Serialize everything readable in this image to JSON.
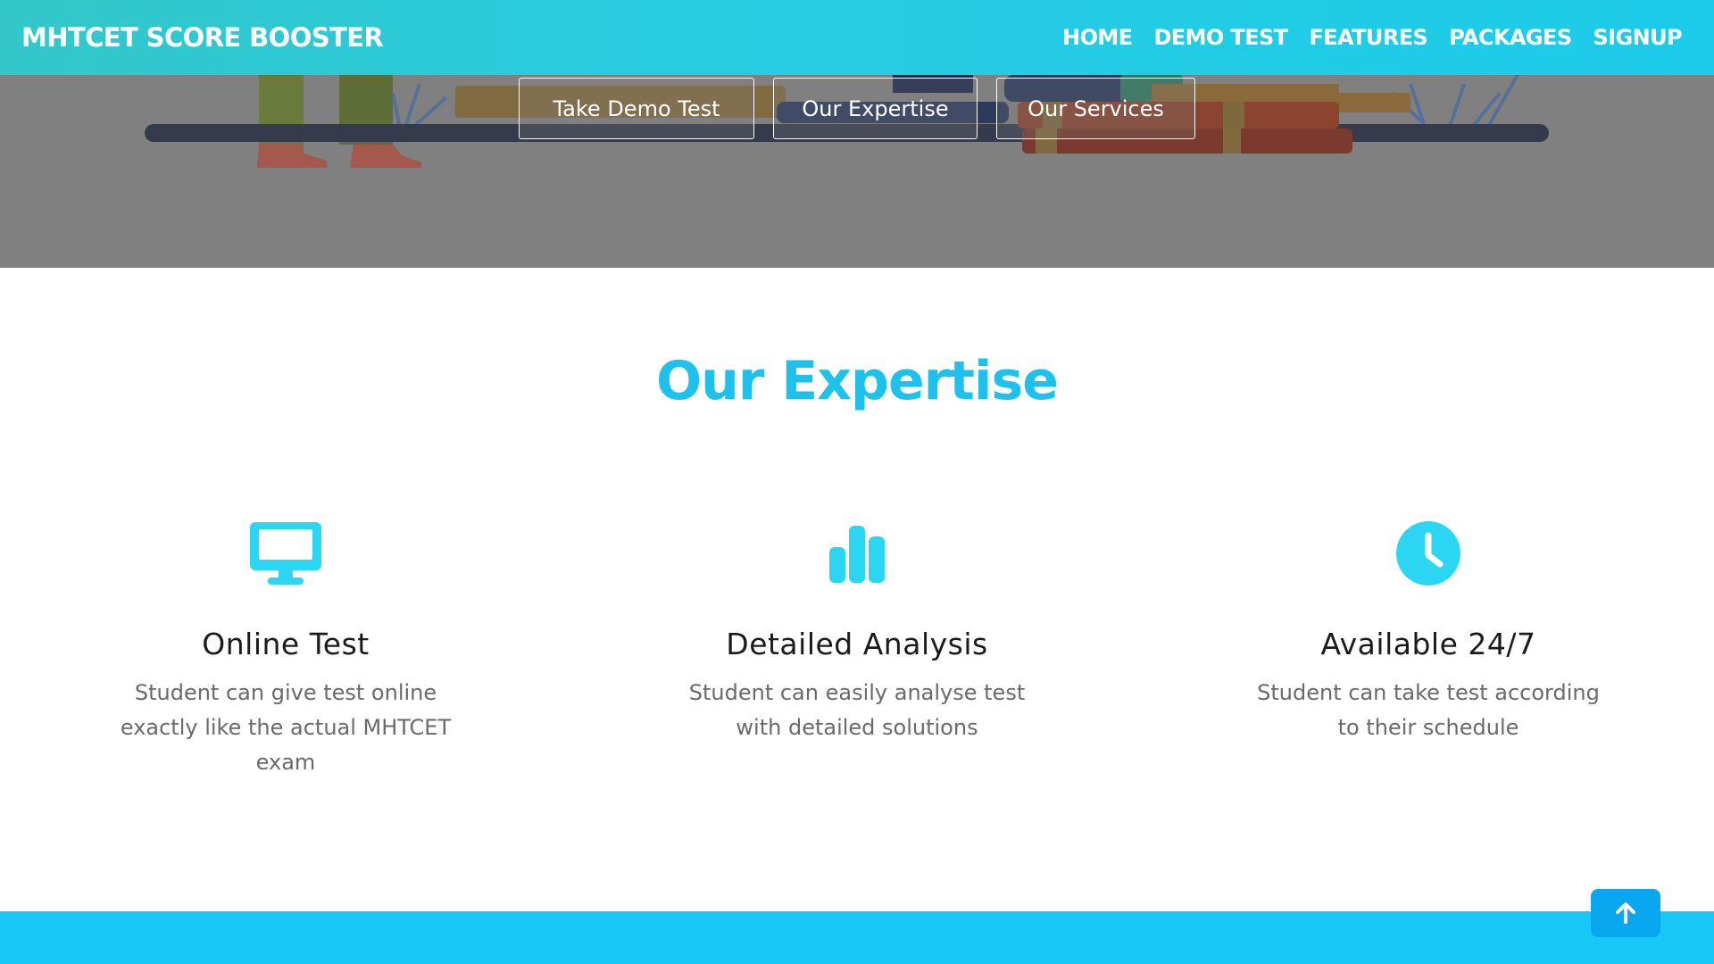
{
  "navbar": {
    "brand": "MHTCET SCORE BOOSTER",
    "links": [
      "HOME",
      "DEMO TEST",
      "FEATURES",
      "PACKAGES",
      "SIGNUP"
    ]
  },
  "hero": {
    "buttons": [
      "Take Demo Test",
      "Our Expertise",
      "Our Services"
    ]
  },
  "expertise": {
    "title": "Our Expertise",
    "features": [
      {
        "icon": "desktop-icon",
        "title": "Online  Test",
        "description": "Student can give test online exactly like the actual MHTCET exam"
      },
      {
        "icon": "bar-chart-icon",
        "title": "Detailed  Analysis",
        "description": "Student can easily analyse test with detailed solutions"
      },
      {
        "icon": "clock-icon",
        "title": "Available  24/7",
        "description": "Student can take test according to their schedule"
      }
    ]
  },
  "colors": {
    "accent": "#1ec0ec",
    "nav_gradient_start": "#33c7c9",
    "nav_gradient_end": "#1ccbea",
    "icon": "#2ad6f2",
    "hero_overlay": "#808080",
    "bottom_bar": "#18c7f5",
    "to_top_button": "#0aa7f1"
  }
}
